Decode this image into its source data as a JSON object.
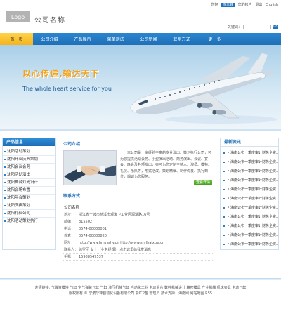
{
  "header": {
    "logo": "Logo",
    "company_name": "公司名称",
    "toplinks": {
      "greeting": "您好",
      "user": "陈三峰",
      "account": "您的帐户",
      "logout": "退出",
      "english": "English"
    },
    "search_label": "关键词：",
    "search_placeholder": "",
    "search_button": "Go"
  },
  "nav": {
    "items": [
      {
        "label": "首　页"
      },
      {
        "label": "公司介绍"
      },
      {
        "label": "产品展示"
      },
      {
        "label": "菜单测试"
      },
      {
        "label": "公司新闻"
      },
      {
        "label": "联系方式"
      },
      {
        "label": "更　多"
      }
    ]
  },
  "banner": {
    "slogan_cn": "以心传递,输达天下",
    "slogan_en": "The whole heart service for you"
  },
  "sidebar": {
    "title": "产品信息",
    "items": [
      {
        "label": "沈阳活动策划"
      },
      {
        "label": "沈阳开业庆典策划"
      },
      {
        "label": "沈阳会议会务"
      },
      {
        "label": "沈阳活动演出"
      },
      {
        "label": "沈阳舞台灯光设计"
      },
      {
        "label": "沈阳会场布置"
      },
      {
        "label": "沈阳年会策划"
      },
      {
        "label": "沈阳庆典策划"
      },
      {
        "label": "沈阳礼仪公司"
      },
      {
        "label": "沈阳活动策划执行"
      }
    ]
  },
  "about": {
    "title": "公司介绍",
    "text": "本公司是一家经验丰富的专业演出、策划执行公司，可为您提供活动会务、小型演出活动、商务演出、会议、宴会、晚会及各项演出，亦可为您定制主持人、演员、模特、礼仪、乐队等，形式活泼、策划精细、制作优良、执行到位，竭诚为您服务。",
    "more_button": "查看详情"
  },
  "contact": {
    "title": "联系方式",
    "company": "公司名称",
    "rows": [
      {
        "key": "地址：",
        "value": "浙江省宁波市慈溪市观海卫工业区润湖路16号"
      },
      {
        "key": "邮编：",
        "value": "315502"
      },
      {
        "key": "电话：",
        "value": "0574-00000001"
      },
      {
        "key": "传真：",
        "value": "0574-00000820"
      },
      {
        "key": "网址：",
        "value": "http://www.hmyarhy.cn http://www.shrlhaixuw.cn"
      },
      {
        "key": "联系人：",
        "value": "徐罗团  女士（业务经理）  点击这里给我发消息"
      },
      {
        "key": "手机：",
        "value": "15988549537"
      }
    ]
  },
  "news": {
    "title": "最新资讯",
    "items": [
      {
        "label": "・海南公布一季度审计财务企资…"
      },
      {
        "label": "・海南公布一季度审计财务企资…"
      },
      {
        "label": "・海南公布一季度审计财务企资…"
      },
      {
        "label": "・海南公布一季度审计财务企资…"
      },
      {
        "label": "・海南公布一季度审计财务企资…"
      },
      {
        "label": "・海南公布一季度审计财务企资…"
      },
      {
        "label": "・海南公布一季度审计财务企资…"
      },
      {
        "label": "・海南公布一季度审计财务企资…"
      },
      {
        "label": "・海南公布一季度审计财务企资…"
      },
      {
        "label": "・海南公布一季度审计财务企资…"
      },
      {
        "label": "・海南公布一季度审计财务企资…"
      }
    ]
  },
  "footer": {
    "line1": "友情链接: 气弹簧模块 气缸 空气弹簧气缸 气缸 液压机械气缸 自动化工业 电动滑台 数控机械设计 精密模具 产业机械 机床夹具 电动气缸",
    "line2": "版权所有 © 宁波华锋自动化设备有限公司  浙ICP备  管理员  技术支持：海南网  网站地图  RSS"
  },
  "colors": {
    "nav_blue": "#1f6fb6",
    "nav_active": "#f5b41b",
    "slogan_orange": "#f3a21b",
    "title_blue": "#1e6db3",
    "more_green": "#3e9b1a"
  }
}
